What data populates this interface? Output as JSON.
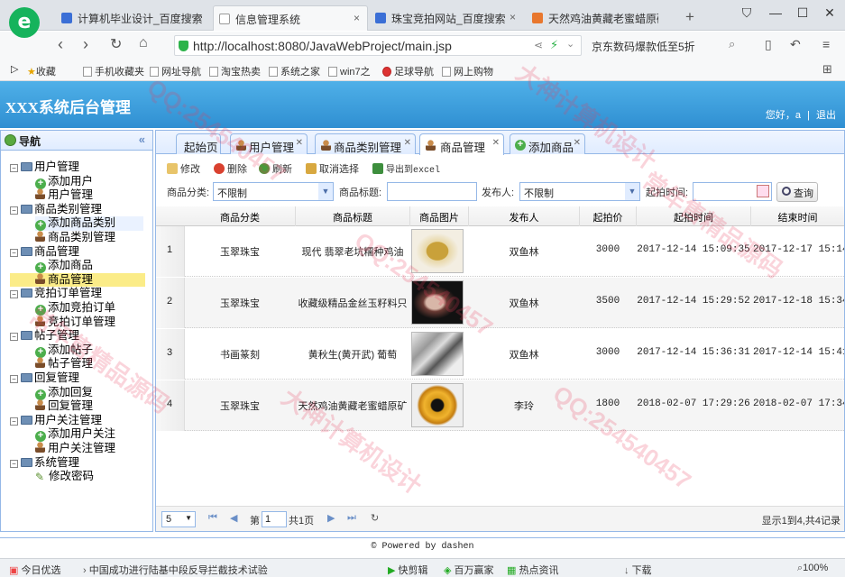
{
  "browser": {
    "tabs": [
      {
        "title": "计算机毕业设计_百度搜索",
        "close": "×"
      },
      {
        "title": "信息管理系统",
        "close": "×"
      },
      {
        "title": "珠宝竞拍网站_百度搜索",
        "close": "×"
      },
      {
        "title": "天然鸡油黄藏老蜜蜡原矿",
        "close": ""
      }
    ],
    "new_tab": "+",
    "url": "http://localhost:8080/JavaWebProject/main.jsp",
    "search_text": "京东数码爆款低至5折",
    "bookmarks": [
      "收藏",
      "手机收藏夹",
      "网址导航",
      "淘宝热卖",
      "系统之家",
      "win7之",
      "足球导航",
      "网上购物"
    ],
    "accent": "#16b35c"
  },
  "app": {
    "title": "XXX系统后台管理",
    "greeting": "您好，a",
    "separator": "|",
    "logout": "退出",
    "header_color": "#2f8fd2"
  },
  "sidebar": {
    "title": "导航",
    "collapse": "«",
    "tree": [
      {
        "label": "用户管理",
        "kind": "group"
      },
      {
        "label": "添加用户",
        "kind": "add"
      },
      {
        "label": "用户管理",
        "kind": "user"
      },
      {
        "label": "商品类别管理",
        "kind": "group"
      },
      {
        "label": "添加商品类别",
        "kind": "add"
      },
      {
        "label": "商品类别管理",
        "kind": "user"
      },
      {
        "label": "商品管理",
        "kind": "group"
      },
      {
        "label": "添加商品",
        "kind": "add"
      },
      {
        "label": "商品管理",
        "kind": "user"
      },
      {
        "label": "竞拍订单管理",
        "kind": "group"
      },
      {
        "label": "添加竞拍订单",
        "kind": "add"
      },
      {
        "label": "竞拍订单管理",
        "kind": "user"
      },
      {
        "label": "帖子管理",
        "kind": "group"
      },
      {
        "label": "添加帖子",
        "kind": "add"
      },
      {
        "label": "帖子管理",
        "kind": "user"
      },
      {
        "label": "回复管理",
        "kind": "group"
      },
      {
        "label": "添加回复",
        "kind": "add"
      },
      {
        "label": "回复管理",
        "kind": "user"
      },
      {
        "label": "用户关注管理",
        "kind": "group"
      },
      {
        "label": "添加用户关注",
        "kind": "add"
      },
      {
        "label": "用户关注管理",
        "kind": "user"
      },
      {
        "label": "系统管理",
        "kind": "group"
      },
      {
        "label": "修改密码",
        "kind": "pen"
      }
    ]
  },
  "tabs": [
    {
      "label": "起始页"
    },
    {
      "label": "用户管理"
    },
    {
      "label": "商品类别管理"
    },
    {
      "label": "商品管理"
    },
    {
      "label": "添加商品"
    }
  ],
  "toolbar": {
    "edit": "修改",
    "delete": "删除",
    "refresh": "刷新",
    "unselect": "取消选择",
    "export": "导出到excel"
  },
  "filter": {
    "category_label": "商品分类:",
    "category_value": "不限制",
    "title_label": "商品标题:",
    "title_value": "",
    "publisher_label": "发布人:",
    "publisher_value": "不限制",
    "start_label": "起拍时间:",
    "start_value": "",
    "query": "查询"
  },
  "grid": {
    "headers": [
      "商品分类",
      "商品标题",
      "商品图片",
      "发布人",
      "起拍价",
      "起拍时间",
      "结束时间"
    ],
    "rows": [
      {
        "n": "1",
        "category": "玉翠珠宝",
        "title": "现代 翡翠老坑糯种鸡油",
        "publisher": "双鱼林",
        "price": "3000",
        "start": "2017-12-14 15:09:35",
        "end": "2017-12-17 15:14:"
      },
      {
        "n": "2",
        "category": "玉翠珠宝",
        "title": "收藏级精品金丝玉籽料只",
        "publisher": "双鱼林",
        "price": "3500",
        "start": "2017-12-14 15:29:52",
        "end": "2017-12-18 15:34:"
      },
      {
        "n": "3",
        "category": "书画篆刻",
        "title": "黄秋生(黄开武) 葡萄",
        "publisher": "双鱼林",
        "price": "3000",
        "start": "2017-12-14 15:36:31",
        "end": "2017-12-14 15:41:"
      },
      {
        "n": "4",
        "category": "玉翠珠宝",
        "title": "天然鸡油黄藏老蜜蜡原矿",
        "publisher": "李玲",
        "price": "1800",
        "start": "2018-02-07 17:29:26",
        "end": "2018-02-07 17:34:"
      }
    ]
  },
  "pager": {
    "page_size": "5",
    "page_prefix": "第",
    "page": "1",
    "page_suffix": "共1页",
    "summary": "显示1到4,共4记录"
  },
  "footer": "© Powered by dashen",
  "statusbar": {
    "left": "今日优选",
    "news": "中国成功进行陆基中段反导拦截技术试验",
    "items": [
      "快剪辑",
      "百万赢家",
      "热点资讯",
      "下载",
      "100%"
    ]
  },
  "watermark": [
    "QQ:254540457",
    "大神计算机设计",
    "常年售精品源码"
  ]
}
